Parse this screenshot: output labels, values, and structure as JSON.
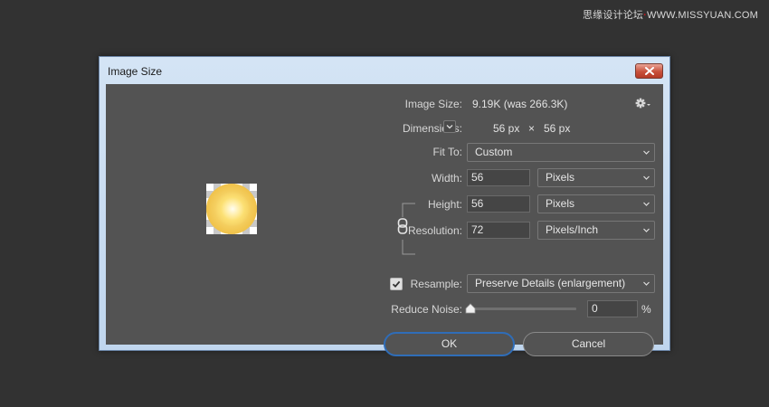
{
  "watermark": {
    "cn": "思缘设计论坛",
    "url": "WWW.MISSYUAN.COM"
  },
  "dialog": {
    "title": "Image Size",
    "image_size": {
      "label": "Image Size:",
      "value": "9.19K (was 266.3K)"
    },
    "dimensions": {
      "label": "Dimensions:",
      "width": "56 px",
      "separator": "×",
      "height": "56 px"
    },
    "fit_to": {
      "label": "Fit To:",
      "value": "Custom"
    },
    "width": {
      "label": "Width:",
      "value": "56",
      "unit": "Pixels"
    },
    "height": {
      "label": "Height:",
      "value": "56",
      "unit": "Pixels"
    },
    "resolution": {
      "label": "Resolution:",
      "value": "72",
      "unit": "Pixels/Inch"
    },
    "resample": {
      "label": "Resample:",
      "checked": true,
      "value": "Preserve Details (enlargement)"
    },
    "reduce_noise": {
      "label": "Reduce Noise:",
      "value": "0",
      "unit": "%",
      "level": 0
    },
    "ok_label": "OK",
    "cancel_label": "Cancel"
  },
  "colors": {
    "client_bg": "#535353",
    "desktop_bg": "#323232",
    "ok_border": "#2f6db8",
    "close_red": "#c8503b"
  },
  "icons": {
    "close": "close-icon",
    "gear": "gear-icon",
    "chevron": "chevron-down-icon",
    "link": "chain-link-icon",
    "check": "checkmark-icon",
    "slider": "slider-thumb-icon"
  }
}
